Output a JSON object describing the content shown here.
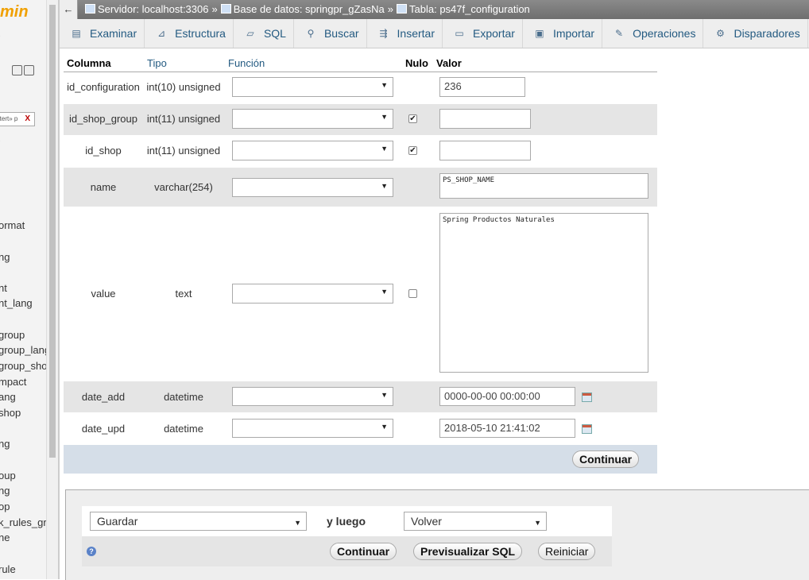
{
  "sidebar": {
    "logo": "min",
    "filter_placeholder": "Intert» p",
    "filter_clear": "X",
    "items": [
      "ormat",
      "ng",
      "nt",
      "nt_lang",
      "group",
      "group_lang",
      "group_sho",
      "mpact",
      "ang",
      "shop",
      "ng",
      "oup",
      "ng",
      "op",
      "k_rules_gr",
      "ne",
      "rule"
    ]
  },
  "breadcrumb": {
    "back": "←",
    "server": "Servidor: localhost:3306",
    "database": "Base de datos: springpr_gZasNa",
    "table": "Tabla: ps47f_configuration",
    "separator": "»"
  },
  "tabs": [
    {
      "label": "Examinar",
      "icon": "browse-icon"
    },
    {
      "label": "Estructura",
      "icon": "structure-icon"
    },
    {
      "label": "SQL",
      "icon": "sql-icon"
    },
    {
      "label": "Buscar",
      "icon": "search-icon"
    },
    {
      "label": "Insertar",
      "icon": "insert-icon"
    },
    {
      "label": "Exportar",
      "icon": "export-icon"
    },
    {
      "label": "Importar",
      "icon": "import-icon"
    },
    {
      "label": "Operaciones",
      "icon": "wrench-icon"
    },
    {
      "label": "Disparadores",
      "icon": "triggers-icon"
    }
  ],
  "table": {
    "headers": {
      "column": "Columna",
      "type": "Tipo",
      "function": "Función",
      "null": "Nulo",
      "value": "Valor"
    },
    "rows": [
      {
        "name": "id_configuration",
        "type": "int(10) unsigned",
        "null": "none",
        "value": "236"
      },
      {
        "name": "id_shop_group",
        "type": "int(11) unsigned",
        "null": "checked",
        "value": ""
      },
      {
        "name": "id_shop",
        "type": "int(11) unsigned",
        "null": "checked",
        "value": ""
      },
      {
        "name": "name",
        "type": "varchar(254)",
        "null": "none",
        "value": "PS_SHOP_NAME"
      },
      {
        "name": "value",
        "type": "text",
        "null": "unchecked",
        "value": "Spring Productos Naturales"
      },
      {
        "name": "date_add",
        "type": "datetime",
        "null": "none",
        "value": "0000-00-00 00:00:00"
      },
      {
        "name": "date_upd",
        "type": "datetime",
        "null": "none",
        "value": "2018-05-10 21:41:02"
      }
    ],
    "continue_label": "Continuar"
  },
  "bottom": {
    "action_select": "Guardar",
    "then_label": "y luego",
    "then_select": "Volver",
    "continue_label": "Continuar",
    "preview_label": "Previsualizar SQL",
    "reset_label": "Reiniciar",
    "help_icon": "help-icon"
  },
  "colors": {
    "tab_text": "#235a81",
    "alt_row": "#e5e5e5",
    "logo": "#f0a000"
  }
}
